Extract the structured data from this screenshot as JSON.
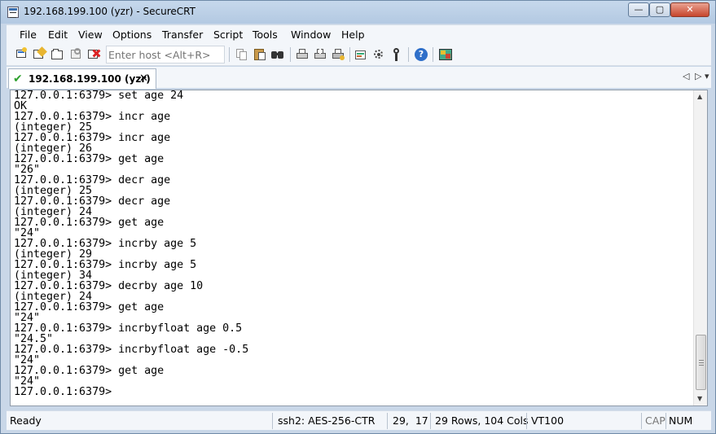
{
  "window": {
    "title": "192.168.199.100 (yzr) - SecureCRT",
    "controls": {
      "minimize": "—",
      "maximize": "▢",
      "close": "✕"
    }
  },
  "menu": [
    "File",
    "Edit",
    "View",
    "Options",
    "Transfer",
    "Script",
    "Tools",
    "Window",
    "Help"
  ],
  "toolbar": {
    "host_placeholder": "Enter host <Alt+R>",
    "icons": [
      "connect-icon",
      "quick-connect-icon",
      "connect-tab-icon",
      "reconnect-icon",
      "disconnect-icon",
      "copy-icon",
      "paste-icon",
      "find-icon",
      "print-icon",
      "print-selection-icon",
      "print-setup-icon",
      "session-options-icon",
      "global-options-icon",
      "keymap-icon",
      "help-icon",
      "sftp-icon"
    ]
  },
  "tab": {
    "label": "192.168.199.100 (yzr)",
    "close": "✕",
    "nav_left": "◁",
    "nav_right": "▷",
    "nav_down": "▾"
  },
  "terminal": {
    "lines": [
      "127.0.0.1:6379> set age 24",
      "OK",
      "127.0.0.1:6379> incr age",
      "(integer) 25",
      "127.0.0.1:6379> incr age",
      "(integer) 26",
      "127.0.0.1:6379> get age",
      "\"26\"",
      "127.0.0.1:6379> decr age",
      "(integer) 25",
      "127.0.0.1:6379> decr age",
      "(integer) 24",
      "127.0.0.1:6379> get age",
      "\"24\"",
      "127.0.0.1:6379> incrby age 5",
      "(integer) 29",
      "127.0.0.1:6379> incrby age 5",
      "(integer) 34",
      "127.0.0.1:6379> decrby age 10",
      "(integer) 24",
      "127.0.0.1:6379> get age",
      "\"24\"",
      "127.0.0.1:6379> incrbyfloat age 0.5",
      "\"24.5\"",
      "127.0.0.1:6379> incrbyfloat age -0.5",
      "\"24\"",
      "127.0.0.1:6379> get age",
      "\"24\"",
      "127.0.0.1:6379> "
    ]
  },
  "statusbar": {
    "state": "Ready",
    "cipher": "ssh2: AES-256-CTR",
    "cursor": "29,  17",
    "size": "29 Rows, 104 Cols",
    "emulation": "VT100",
    "caps": "CAP",
    "num": "NUM"
  },
  "colors": {
    "titlebar": "#b8cde4",
    "close_button": "#c7452c",
    "connected_check": "#2ea12e",
    "terminal_bg": "#ffffff"
  }
}
